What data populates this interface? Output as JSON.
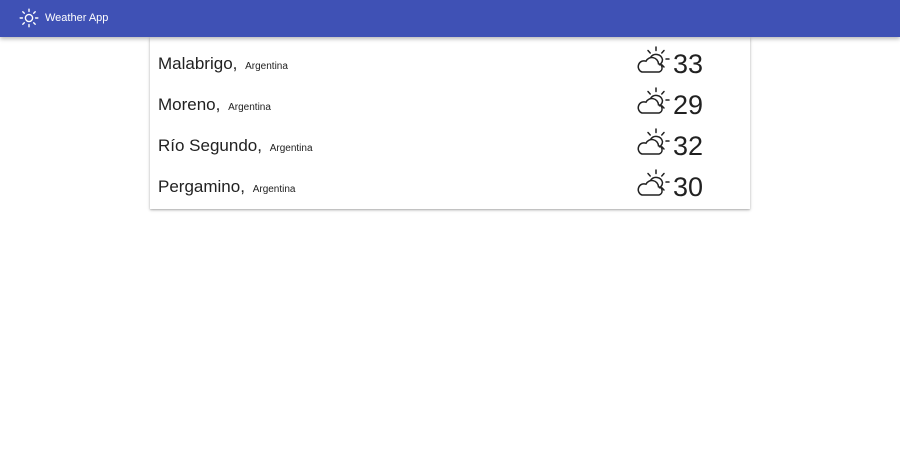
{
  "appbar": {
    "icon": "sun-icon",
    "title": "Weather App",
    "background_color": "#3f51b5"
  },
  "cities": [
    {
      "name": "Malabrigo",
      "separator": ",",
      "country": "Argentina",
      "icon": "partly-cloudy-icon",
      "temperature": "33"
    },
    {
      "name": "Moreno",
      "separator": ",",
      "country": "Argentina",
      "icon": "partly-cloudy-icon",
      "temperature": "29"
    },
    {
      "name": "Río Segundo",
      "separator": ",",
      "country": "Argentina",
      "icon": "partly-cloudy-icon",
      "temperature": "32"
    },
    {
      "name": "Pergamino",
      "separator": ",",
      "country": "Argentina",
      "icon": "partly-cloudy-icon",
      "temperature": "30"
    }
  ]
}
